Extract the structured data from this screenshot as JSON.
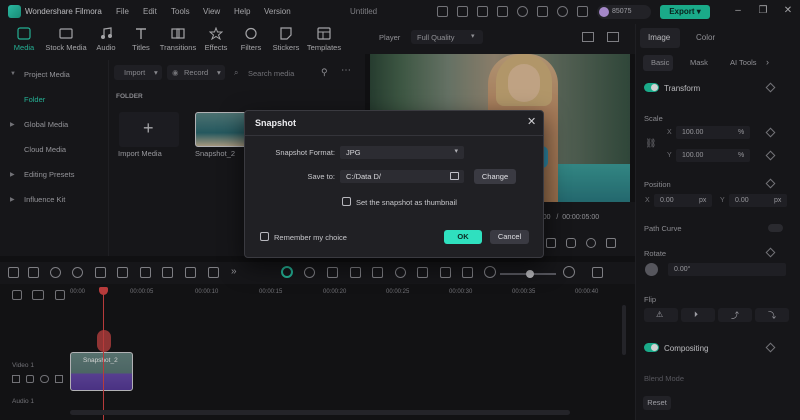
{
  "app": {
    "name": "Wondershare Filmora",
    "menu": [
      "File",
      "Edit",
      "Tools",
      "View",
      "Help",
      "Version"
    ],
    "document_title": "Untitled",
    "credits": "85075",
    "export_label": "Export",
    "accent": "#20d0a8"
  },
  "toolbar": {
    "items": [
      {
        "label": "Media",
        "icon": "media-icon",
        "active": true
      },
      {
        "label": "Stock Media",
        "icon": "stock-media-icon"
      },
      {
        "label": "Audio",
        "icon": "audio-icon"
      },
      {
        "label": "Titles",
        "icon": "titles-icon"
      },
      {
        "label": "Transitions",
        "icon": "transitions-icon"
      },
      {
        "label": "Effects",
        "icon": "effects-icon"
      },
      {
        "label": "Filters",
        "icon": "filters-icon"
      },
      {
        "label": "Stickers",
        "icon": "stickers-icon"
      },
      {
        "label": "Templates",
        "icon": "templates-icon"
      }
    ]
  },
  "sidebar": {
    "items": [
      {
        "label": "Project Media",
        "expandable": true
      },
      {
        "label": "Folder",
        "active": true
      },
      {
        "label": "Global Media",
        "expandable": true
      },
      {
        "label": "Cloud Media"
      },
      {
        "label": "Editing Presets",
        "expandable": true
      },
      {
        "label": "Influence Kit",
        "expandable": true
      }
    ]
  },
  "media": {
    "import_label": "Import",
    "record_label": "Record",
    "search_placeholder": "Search media",
    "folder_header": "FOLDER",
    "import_tile_label": "Import Media",
    "clip_label": "Snapshot_2"
  },
  "player": {
    "tab_label": "Player",
    "quality": "Full Quality",
    "time_current": "00:00",
    "time_total": "00:00:05:00"
  },
  "right_panel": {
    "tabs": [
      "Image",
      "Color"
    ],
    "subtabs": [
      "Basic",
      "Mask",
      "AI Tools"
    ],
    "transform_label": "Transform",
    "scale_label": "Scale",
    "scale_x": "100.00",
    "scale_y": "100.00",
    "scale_unit": "%",
    "position_label": "Position",
    "pos_x": "0.00",
    "pos_y": "0.00",
    "pos_unit": "px",
    "path_curve_label": "Path Curve",
    "rotate_label": "Rotate",
    "rotate_value": "0.00°",
    "flip_label": "Flip",
    "compositing_label": "Compositing",
    "blend_mode_label": "Blend Mode",
    "reset_label": "Reset"
  },
  "timeline": {
    "ticks": [
      "00:00",
      "00:00:05",
      "00:00:10",
      "00:00:15",
      "00:00:20",
      "00:00:25",
      "00:00:30",
      "00:00:35",
      "00:00:40"
    ],
    "video_track_label": "Video 1",
    "audio_track_label": "Audio 1",
    "clip_label": "Snapshot_2"
  },
  "dialog": {
    "title": "Snapshot",
    "format_label": "Snapshot Format:",
    "format_value": "JPG",
    "save_to_label": "Save to:",
    "save_to_value": "C:/Data D/",
    "change_label": "Change",
    "thumbnail_label": "Set the snapshot as thumbnail",
    "remember_label": "Remember my choice",
    "ok_label": "OK",
    "cancel_label": "Cancel"
  }
}
